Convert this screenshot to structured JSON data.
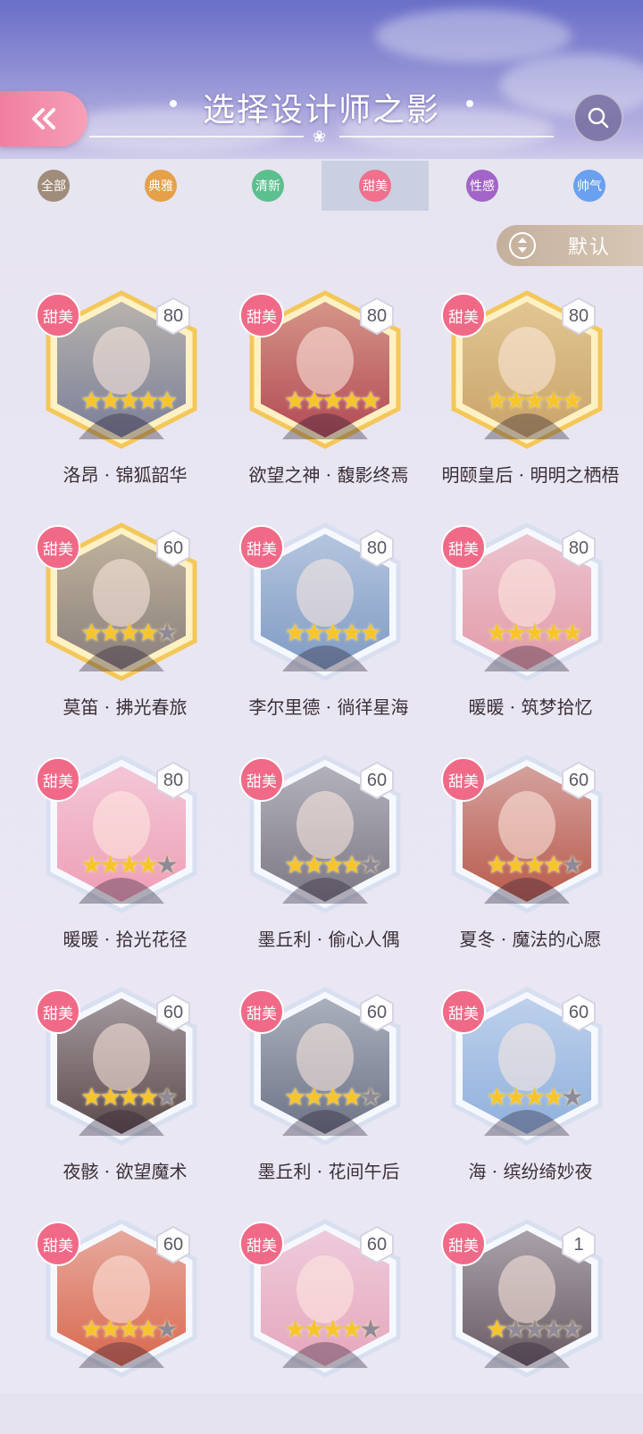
{
  "header": {
    "title": "选择设计师之影"
  },
  "tabs": [
    {
      "label": "全部",
      "color": "#a08c7a",
      "active": false
    },
    {
      "label": "典雅",
      "color": "#e6a04a",
      "active": false
    },
    {
      "label": "清新",
      "color": "#5cbf8e",
      "active": false
    },
    {
      "label": "甜美",
      "color": "#f0708e",
      "active": true
    },
    {
      "label": "性感",
      "color": "#a264c8",
      "active": false
    },
    {
      "label": "帅气",
      "color": "#6aa0f0",
      "active": false
    }
  ],
  "sort": {
    "label": "默认"
  },
  "cards": [
    {
      "tag": "甜美",
      "level": "80",
      "name": "洛昂 · 锦狐韶华",
      "stars": 5,
      "frame": "gold",
      "portrait": "#7b7f99"
    },
    {
      "tag": "甜美",
      "level": "80",
      "name": "欲望之神 · 馥影终焉",
      "stars": 5,
      "frame": "gold",
      "portrait": "#b24a55"
    },
    {
      "tag": "甜美",
      "level": "80",
      "name": "明颐皇后 · 明明之栖梧",
      "stars": 5,
      "frame": "gold",
      "portrait": "#c9a36a"
    },
    {
      "tag": "甜美",
      "level": "60",
      "name": "莫笛 · 拂光春旅",
      "stars": 4,
      "frame": "gold",
      "portrait": "#8a7f7c"
    },
    {
      "tag": "甜美",
      "level": "80",
      "name": "李尔里德 · 徜徉星海",
      "stars": 5,
      "frame": "silver",
      "portrait": "#7f9bc4"
    },
    {
      "tag": "甜美",
      "level": "80",
      "name": "暖暖 · 筑梦拾忆",
      "stars": 5,
      "frame": "silver",
      "portrait": "#e39aa8"
    },
    {
      "tag": "甜美",
      "level": "80",
      "name": "暖暖 · 拾光花径",
      "stars": 4,
      "frame": "silver",
      "portrait": "#ef9eb6"
    },
    {
      "tag": "甜美",
      "level": "60",
      "name": "墨丘利 · 偷心人偶",
      "stars": 4,
      "frame": "silver",
      "portrait": "#7c7885"
    },
    {
      "tag": "甜美",
      "level": "60",
      "name": "夏冬 · 魔法的心愿",
      "stars": 4,
      "frame": "silver",
      "portrait": "#b85a4c"
    },
    {
      "tag": "甜美",
      "level": "60",
      "name": "夜骸 · 欲望魔术",
      "stars": 4,
      "frame": "silver",
      "portrait": "#5d4a4c"
    },
    {
      "tag": "甜美",
      "level": "60",
      "name": "墨丘利 · 花间午后",
      "stars": 4,
      "frame": "silver",
      "portrait": "#6d7486"
    },
    {
      "tag": "甜美",
      "level": "60",
      "name": "海 · 缤纷绮妙夜",
      "stars": 4,
      "frame": "silver",
      "portrait": "#8fb0dc"
    },
    {
      "tag": "甜美",
      "level": "60",
      "name": "",
      "stars": 4,
      "frame": "silver",
      "portrait": "#d9684e"
    },
    {
      "tag": "甜美",
      "level": "60",
      "name": "",
      "stars": 4,
      "frame": "silver",
      "portrait": "#e6a6bd"
    },
    {
      "tag": "甜美",
      "level": "1",
      "name": "",
      "stars": 1,
      "frame": "silver",
      "portrait": "#6a5b64"
    }
  ]
}
